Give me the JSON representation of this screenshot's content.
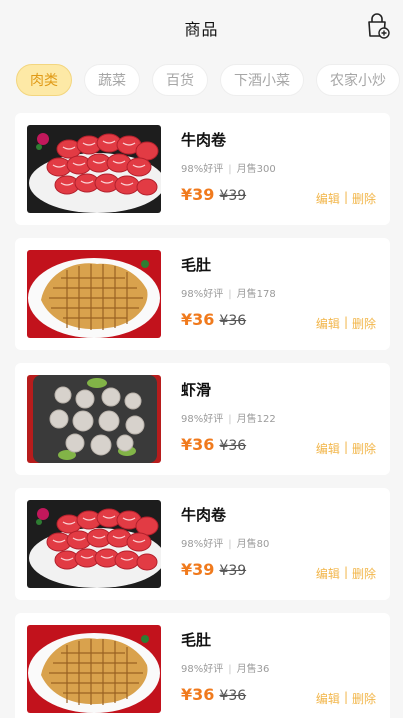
{
  "header": {
    "title": "商品"
  },
  "tabs": [
    {
      "label": "肉类",
      "active": true
    },
    {
      "label": "蔬菜",
      "active": false
    },
    {
      "label": "百货",
      "active": false
    },
    {
      "label": "下酒小菜",
      "active": false
    },
    {
      "label": "农家小炒",
      "active": false
    }
  ],
  "products": [
    {
      "name": "牛肉卷",
      "rating": "98%好评",
      "sales": "月售300",
      "price": "¥39",
      "orig_price": "¥39",
      "edit": "编辑",
      "delete": "删除",
      "image": "beef-roll"
    },
    {
      "name": "毛肚",
      "rating": "98%好评",
      "sales": "月售178",
      "price": "¥36",
      "orig_price": "¥36",
      "edit": "编辑",
      "delete": "删除",
      "image": "tripe"
    },
    {
      "name": "虾滑",
      "rating": "98%好评",
      "sales": "月售122",
      "price": "¥36",
      "orig_price": "¥36",
      "edit": "编辑",
      "delete": "删除",
      "image": "shrimp-paste"
    },
    {
      "name": "牛肉卷",
      "rating": "98%好评",
      "sales": "月售80",
      "price": "¥39",
      "orig_price": "¥39",
      "edit": "编辑",
      "delete": "删除",
      "image": "beef-roll"
    },
    {
      "name": "毛肚",
      "rating": "98%好评",
      "sales": "月售36",
      "price": "¥36",
      "orig_price": "¥36",
      "edit": "编辑",
      "delete": "删除",
      "image": "tripe"
    }
  ],
  "colors": {
    "accent": "#f07a1d",
    "action": "#f2b64a",
    "tab_active_bg": "#fde9a6"
  }
}
